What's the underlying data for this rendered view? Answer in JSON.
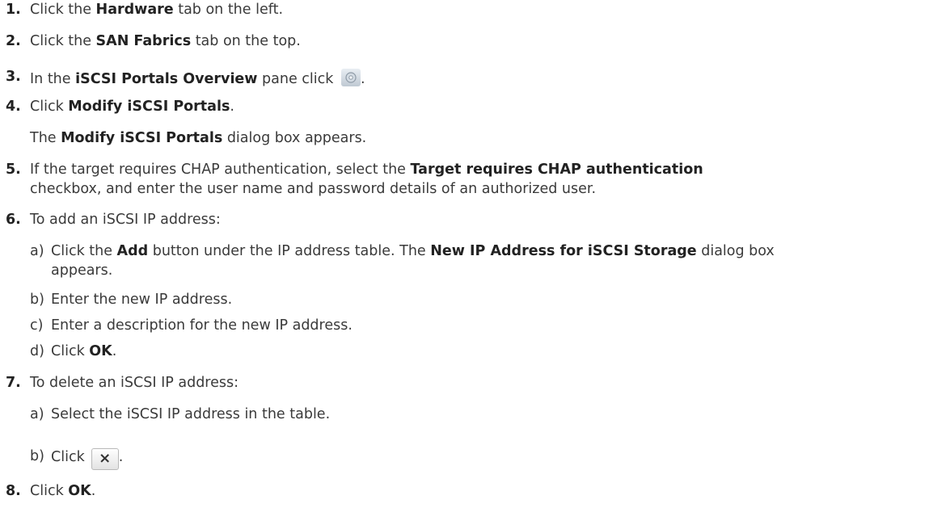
{
  "steps": [
    {
      "num": "1.",
      "pre": "Click the ",
      "bold": "Hardware",
      "post": " tab on the left."
    },
    {
      "num": "2.",
      "pre": "Click the ",
      "bold": "SAN Fabrics",
      "post": " tab on the top."
    },
    {
      "num": "3.",
      "pre": "In the ",
      "bold": "iSCSI Portals Overview",
      "post": " pane click ",
      "end": "."
    },
    {
      "num": "4.",
      "pre": "Click ",
      "bold": "Modify iSCSI Portals",
      "post": ".",
      "note_pre": "The ",
      "note_bold": "Modify iSCSI Portals",
      "note_post": " dialog box appears."
    },
    {
      "num": "5.",
      "pre": "If the target requires CHAP authentication, select the ",
      "bold": "Target requires CHAP authentication",
      "line2": "checkbox, and enter the user name and password details of an authorized user."
    },
    {
      "num": "6.",
      "text": "To add an iSCSI IP address:"
    },
    {
      "num": "7.",
      "text": "To delete an iSCSI IP address:"
    },
    {
      "num": "8.",
      "pre": "Click ",
      "bold": "OK",
      "post": "."
    }
  ],
  "step6_sub": {
    "a_label": "a)",
    "a_pre": "Click the ",
    "a_bold": "Add",
    "a_mid": " button under the IP address table. The ",
    "a_bold2": "New IP Address for iSCSI Storage",
    "a_post": " dialog box",
    "a_line2": "appears.",
    "b_label": "b)",
    "b_text": "Enter the new IP address.",
    "c_label": "c)",
    "c_text": "Enter a description for the new IP address.",
    "d_label": "d)",
    "d_pre": "Click ",
    "d_bold": "OK",
    "d_post": "."
  },
  "step7_sub": {
    "a_label": "a)",
    "a_text": "Select the iSCSI IP address in the table.",
    "b_label": "b)",
    "b_pre": "Click",
    "b_icon": "×",
    "b_post": "."
  },
  "icons": {
    "step3": "gear-icon",
    "step7b": "close-icon"
  }
}
